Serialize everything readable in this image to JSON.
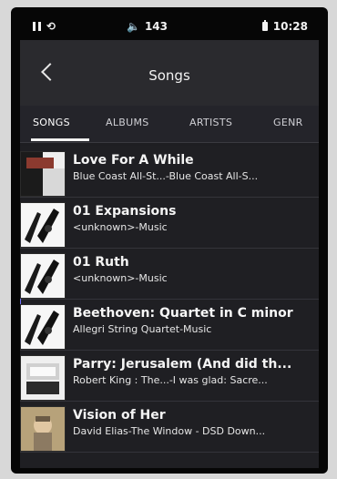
{
  "status_bar": {
    "volume": "143",
    "time": "10:28",
    "icons": {
      "left": [
        "pause-icon",
        "repeat-icon"
      ],
      "mid": [
        "speaker-icon"
      ],
      "right": [
        "battery-icon"
      ]
    }
  },
  "header": {
    "title": "Songs",
    "back_icon": "chevron-left-icon"
  },
  "tabs": [
    {
      "label": "SONGS",
      "active": true
    },
    {
      "label": "ALBUMS",
      "active": false
    },
    {
      "label": "ARTISTS",
      "active": false
    },
    {
      "label": "GENR",
      "active": false
    }
  ],
  "songs": [
    {
      "title": "Love For A While",
      "subtitle": "Blue Coast All-St...-Blue Coast All-S..."
    },
    {
      "title": "01 Expansions",
      "subtitle": "<unknown>-Music"
    },
    {
      "title": "01 Ruth",
      "subtitle": "<unknown>-Music"
    },
    {
      "title": "Beethoven: Quartet in C minor",
      "subtitle": "Allegri String Quartet-Music"
    },
    {
      "title": "Parry: Jerusalem (And did th...",
      "subtitle": "Robert King : The...-I was glad: Sacre..."
    },
    {
      "title": "Vision of Her",
      "subtitle": "David Elias-The Window - DSD Down..."
    }
  ],
  "colors": {
    "background": "#1f1f23",
    "header": "#2a2a2e",
    "text": "#f4f4f4",
    "accent": "#f2f2f2"
  }
}
